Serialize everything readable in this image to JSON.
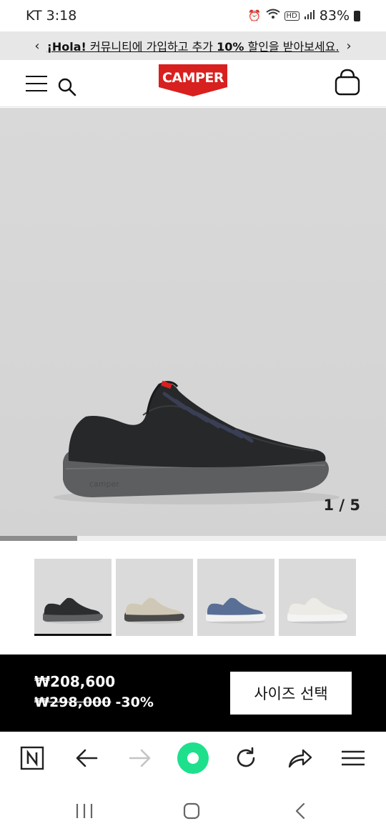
{
  "status_bar": {
    "carrier_time": "KT 3:18",
    "hd_label": "HD",
    "battery": "83%"
  },
  "promo": {
    "text_bold": "¡Hola!",
    "text_main": " 커뮤니티에 가입하고 추가 ",
    "text_percent": "10%",
    "text_end": " 할인을 받아보세요."
  },
  "header": {
    "logo_text": "CAMPER"
  },
  "gallery": {
    "counter": "1 / 5",
    "progress": 0.2,
    "thumbnails": [
      {
        "name": "black",
        "upper": "#2c2d2f",
        "sole": "#5e5f61",
        "active": true
      },
      {
        "name": "beige",
        "upper": "#cfc8b6",
        "sole": "#4a4a4a",
        "active": false
      },
      {
        "name": "blue",
        "upper": "#5a6f96",
        "sole": "#f2f2f2",
        "active": false
      },
      {
        "name": "white",
        "upper": "#ecebe6",
        "sole": "#f4f4f4",
        "active": false
      }
    ]
  },
  "buy_bar": {
    "price_now": "₩208,600",
    "price_old": "₩298,000",
    "discount": "-30%",
    "size_button": "사이즈 선택"
  },
  "colors": {
    "brand_red": "#d8201e",
    "accent_green": "#1ee08c"
  }
}
